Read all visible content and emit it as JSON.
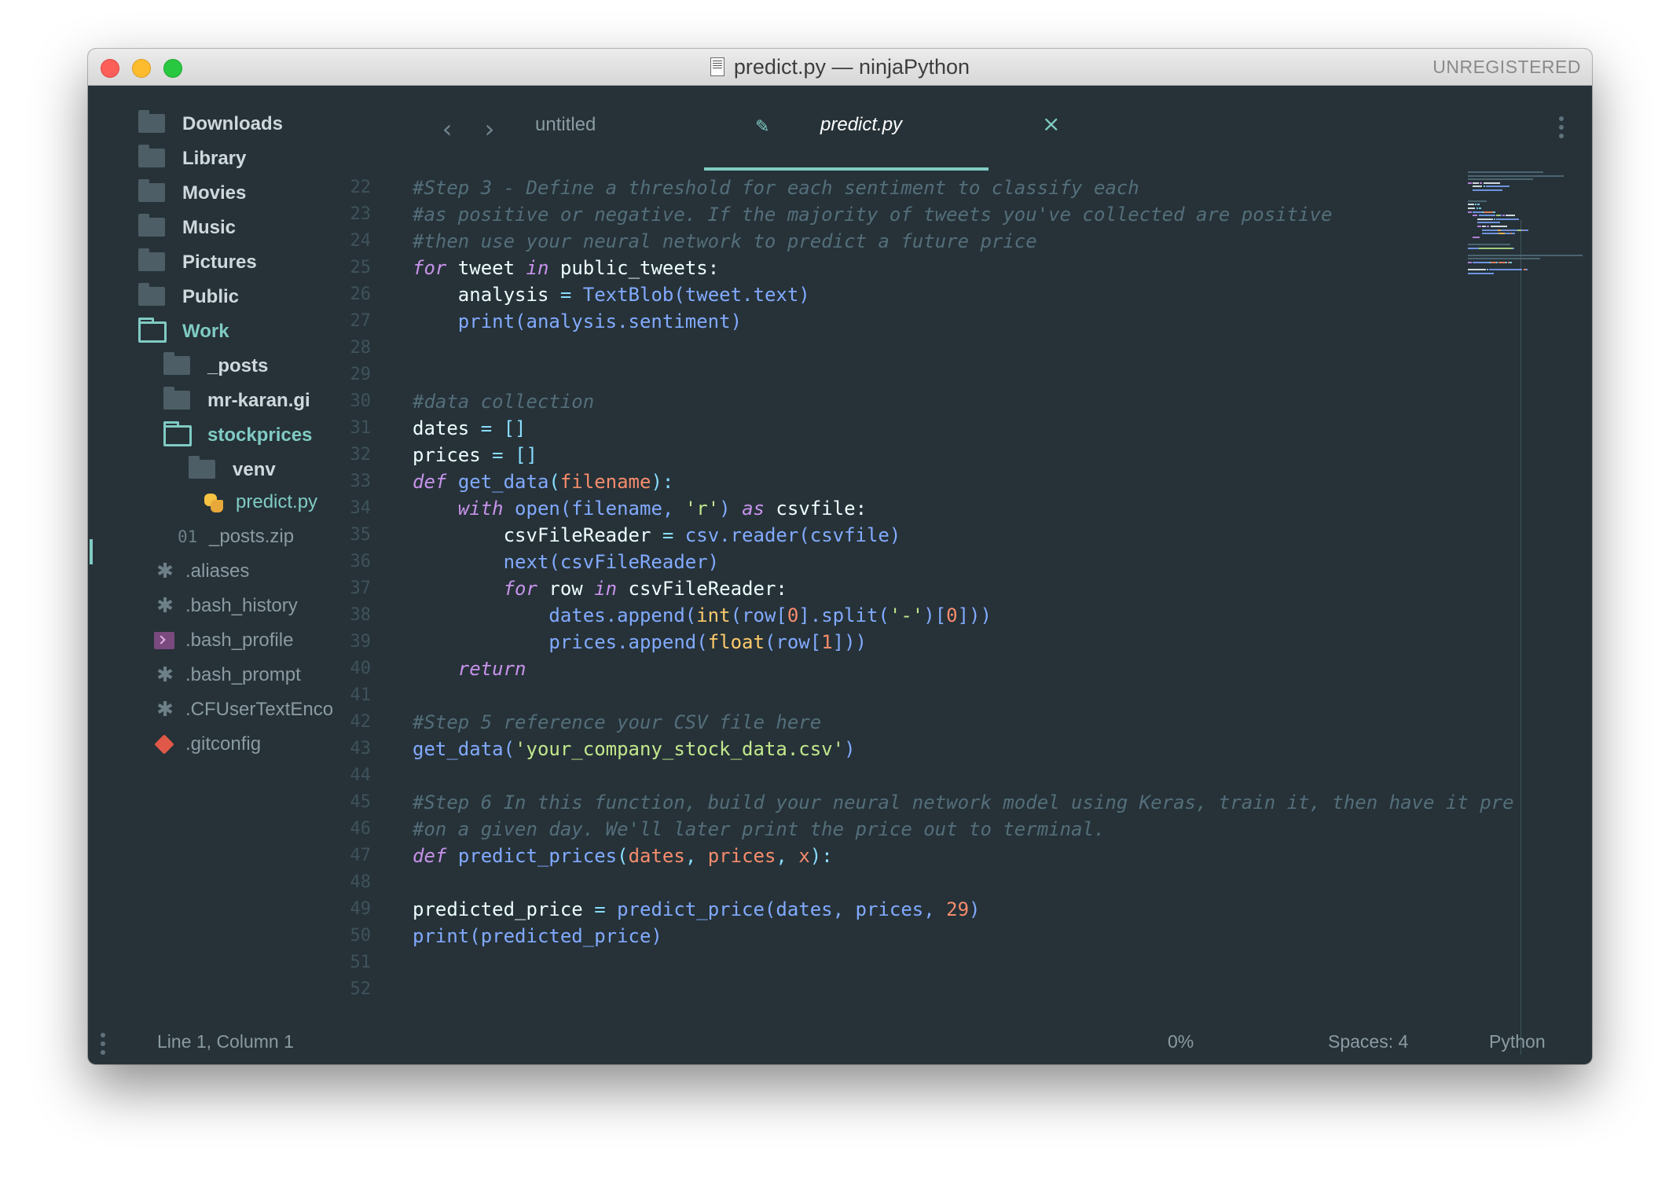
{
  "window": {
    "title": "predict.py — ninjaPython",
    "badge": "UNREGISTERED"
  },
  "sidebar": {
    "items": [
      {
        "label": "Downloads",
        "icon": "folder-icon"
      },
      {
        "label": "Library",
        "icon": "folder-icon"
      },
      {
        "label": "Movies",
        "icon": "folder-icon"
      },
      {
        "label": "Music",
        "icon": "folder-icon"
      },
      {
        "label": "Pictures",
        "icon": "folder-icon"
      },
      {
        "label": "Public",
        "icon": "folder-icon"
      },
      {
        "label": "Work",
        "icon": "folder-open-icon"
      },
      {
        "label": "_posts",
        "icon": "folder-icon"
      },
      {
        "label": "mr-karan.gi",
        "icon": "folder-icon"
      },
      {
        "label": "stockprices",
        "icon": "folder-open-icon"
      },
      {
        "label": "venv",
        "icon": "folder-icon"
      },
      {
        "label": "predict.py",
        "icon": "python-file-icon"
      },
      {
        "label": "_posts.zip",
        "icon": "zip-file-icon",
        "icon_text": "01"
      },
      {
        "label": ".aliases",
        "icon": "asterisk-file-icon"
      },
      {
        "label": ".bash_history",
        "icon": "asterisk-file-icon"
      },
      {
        "label": ".bash_profile",
        "icon": "terminal-file-icon"
      },
      {
        "label": ".bash_prompt",
        "icon": "asterisk-file-icon"
      },
      {
        "label": ".CFUserTextEnco",
        "icon": "asterisk-file-icon"
      },
      {
        "label": ".gitconfig",
        "icon": "git-file-icon"
      }
    ]
  },
  "tabs": [
    {
      "label": "untitled",
      "active": false
    },
    {
      "label": "predict.py",
      "active": true
    }
  ],
  "editor": {
    "line_numbers": [
      "22",
      "23",
      "24",
      "25",
      "26",
      "27",
      "28",
      "29",
      "30",
      "31",
      "32",
      "33",
      "34",
      "35",
      "36",
      "37",
      "38",
      "39",
      "40",
      "41",
      "42",
      "43",
      "44",
      "45",
      "46",
      "47",
      "48",
      "49",
      "50",
      "51",
      "52"
    ],
    "lines": [
      [
        {
          "t": "c",
          "v": "#Step 3 - Define a threshold for each sentiment to classify each"
        }
      ],
      [
        {
          "t": "c",
          "v": "#as positive or negative. If the majority of tweets you've collected are positive"
        }
      ],
      [
        {
          "t": "c",
          "v": "#then use your neural network to predict a future price"
        }
      ],
      [
        {
          "t": "k",
          "v": "for"
        },
        {
          "t": "x",
          "v": " tweet "
        },
        {
          "t": "k",
          "v": "in"
        },
        {
          "t": "x",
          "v": " public_tweets:"
        }
      ],
      [
        {
          "t": "x",
          "v": "    analysis "
        },
        {
          "t": "o",
          "v": "="
        },
        {
          "t": "x",
          "v": " "
        },
        {
          "t": "f",
          "v": "TextBlob(tweet.text)"
        }
      ],
      [
        {
          "t": "x",
          "v": "    "
        },
        {
          "t": "f",
          "v": "print(analysis.sentiment)"
        }
      ],
      [],
      [],
      [
        {
          "t": "c",
          "v": "#data collection"
        }
      ],
      [
        {
          "t": "x",
          "v": "dates "
        },
        {
          "t": "o",
          "v": "="
        },
        {
          "t": "x",
          "v": " "
        },
        {
          "t": "o",
          "v": "[]"
        }
      ],
      [
        {
          "t": "x",
          "v": "prices "
        },
        {
          "t": "o",
          "v": "="
        },
        {
          "t": "x",
          "v": " "
        },
        {
          "t": "o",
          "v": "[]"
        }
      ],
      [
        {
          "t": "k",
          "v": "def"
        },
        {
          "t": "x",
          "v": " "
        },
        {
          "t": "f",
          "v": "get_data"
        },
        {
          "t": "o",
          "v": "("
        },
        {
          "t": "p",
          "v": "filename"
        },
        {
          "t": "o",
          "v": "):"
        }
      ],
      [
        {
          "t": "x",
          "v": "    "
        },
        {
          "t": "k",
          "v": "with"
        },
        {
          "t": "x",
          "v": " "
        },
        {
          "t": "f",
          "v": "open(filename, "
        },
        {
          "t": "s",
          "v": "'r'"
        },
        {
          "t": "f",
          "v": ")"
        },
        {
          "t": "x",
          "v": " "
        },
        {
          "t": "k",
          "v": "as"
        },
        {
          "t": "x",
          "v": " csvfile:"
        }
      ],
      [
        {
          "t": "x",
          "v": "        csvFileReader "
        },
        {
          "t": "o",
          "v": "="
        },
        {
          "t": "x",
          "v": " "
        },
        {
          "t": "f",
          "v": "csv.reader(csvfile)"
        }
      ],
      [
        {
          "t": "x",
          "v": "        "
        },
        {
          "t": "f",
          "v": "next(csvFileReader)"
        }
      ],
      [
        {
          "t": "x",
          "v": "        "
        },
        {
          "t": "k",
          "v": "for"
        },
        {
          "t": "x",
          "v": " row "
        },
        {
          "t": "k",
          "v": "in"
        },
        {
          "t": "x",
          "v": " csvFileReader:"
        }
      ],
      [
        {
          "t": "x",
          "v": "            "
        },
        {
          "t": "f",
          "v": "dates.append("
        },
        {
          "t": "b",
          "v": "int"
        },
        {
          "t": "f",
          "v": "(row["
        },
        {
          "t": "n",
          "v": "0"
        },
        {
          "t": "f",
          "v": "].split("
        },
        {
          "t": "s",
          "v": "'-'"
        },
        {
          "t": "f",
          "v": ")["
        },
        {
          "t": "n",
          "v": "0"
        },
        {
          "t": "f",
          "v": "]))"
        }
      ],
      [
        {
          "t": "x",
          "v": "            "
        },
        {
          "t": "f",
          "v": "prices.append("
        },
        {
          "t": "b",
          "v": "float"
        },
        {
          "t": "f",
          "v": "(row["
        },
        {
          "t": "n",
          "v": "1"
        },
        {
          "t": "f",
          "v": "]))"
        }
      ],
      [
        {
          "t": "x",
          "v": "    "
        },
        {
          "t": "k",
          "v": "return"
        }
      ],
      [],
      [
        {
          "t": "c",
          "v": "#Step 5 reference your CSV file here"
        }
      ],
      [
        {
          "t": "f",
          "v": "get_data("
        },
        {
          "t": "s",
          "v": "'your_company_stock_data.csv'"
        },
        {
          "t": "f",
          "v": ")"
        }
      ],
      [],
      [
        {
          "t": "c",
          "v": "#Step 6 In this function, build your neural network model using Keras, train it, then have it pre"
        }
      ],
      [
        {
          "t": "c",
          "v": "#on a given day. We'll later print the price out to terminal."
        }
      ],
      [
        {
          "t": "k",
          "v": "def"
        },
        {
          "t": "x",
          "v": " "
        },
        {
          "t": "f",
          "v": "predict_prices"
        },
        {
          "t": "o",
          "v": "("
        },
        {
          "t": "p",
          "v": "dates"
        },
        {
          "t": "o",
          "v": ", "
        },
        {
          "t": "p",
          "v": "prices"
        },
        {
          "t": "o",
          "v": ", "
        },
        {
          "t": "p",
          "v": "x"
        },
        {
          "t": "o",
          "v": "):"
        }
      ],
      [],
      [
        {
          "t": "x",
          "v": "predicted_price "
        },
        {
          "t": "o",
          "v": "="
        },
        {
          "t": "x",
          "v": " "
        },
        {
          "t": "f",
          "v": "predict_price(dates, prices, "
        },
        {
          "t": "n",
          "v": "29"
        },
        {
          "t": "f",
          "v": ")"
        }
      ],
      [
        {
          "t": "f",
          "v": "print(predicted_price)"
        }
      ],
      [],
      []
    ]
  },
  "status": {
    "position": "Line 1, Column 1",
    "scroll": "0%",
    "indent": "Spaces: 4",
    "syntax": "Python"
  },
  "colors": {
    "background": "#263238",
    "accent": "#80cbc4",
    "comment": "#546e7a",
    "keyword": "#c792ea",
    "function": "#82aaff",
    "string": "#c3e88d",
    "number": "#f78c6c"
  }
}
